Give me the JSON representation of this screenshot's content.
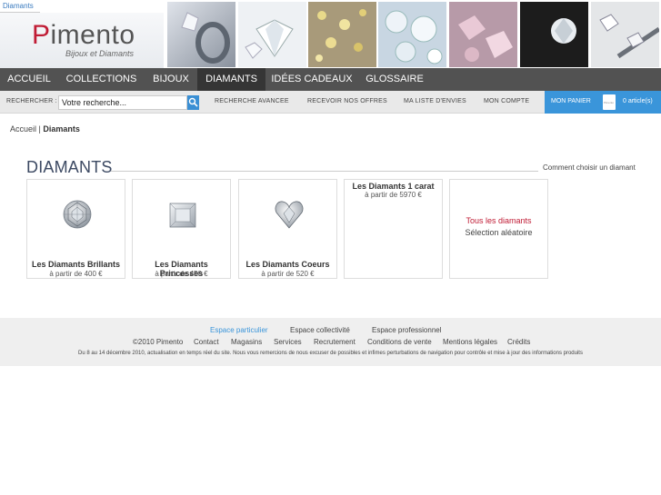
{
  "top_tab": {
    "label": "Diamants"
  },
  "logo": {
    "word_first": "P",
    "word_rest": "imento",
    "tagline": "Bijoux et Diamants"
  },
  "nav": {
    "items": [
      {
        "label": "ACCUEIL",
        "active": false
      },
      {
        "label": "COLLECTIONS",
        "active": false
      },
      {
        "label": "BIJOUX",
        "active": false
      },
      {
        "label": "DIAMANTS",
        "active": true
      },
      {
        "label": "IDÉES CADEAUX",
        "active": false
      },
      {
        "label": "GLOSSAIRE",
        "active": false
      }
    ]
  },
  "toolbar": {
    "search_label": "RECHERCHER :",
    "search_value": "Votre recherche...",
    "advanced": "RECHERCHE AVANCEE",
    "offers": "RECEVOIR NOS OFFRES",
    "wishlist": "MA LISTE D'ENVIES",
    "account": "MON COMPTE",
    "cart_label": "MON PANIER",
    "cart_count": "0 article(s)",
    "cart_bag_text": "Pimento"
  },
  "breadcrumb": {
    "home": "Accueil",
    "separator": " | ",
    "current": "Diamants"
  },
  "section": {
    "title": "DIAMANTS",
    "choose_link": "Comment choisir un diamant"
  },
  "cards": [
    {
      "title": "Les Diamants Brillants",
      "price": "à partir de 400 €",
      "shape": "round"
    },
    {
      "title": "Les Diamants Princesses",
      "price": "à partir de 450 €",
      "shape": "princess"
    },
    {
      "title": "Les Diamants Coeurs",
      "price": "à partir de 520 €",
      "shape": "heart"
    },
    {
      "title": "Les Diamants 1 carat",
      "price": "à partir de 5970 €",
      "shape": "none"
    }
  ],
  "extra_card": {
    "all_link": "Tous les diamants",
    "random_link": "Sélection aléatoire"
  },
  "footer": {
    "spaces": [
      "Espace particulier",
      "Espace collectivité",
      "Espace professionnel"
    ],
    "links": [
      "©2010 Pimento",
      "Contact",
      "Magasins",
      "Services",
      "Recrutement",
      "Conditions de vente",
      "Mentions légales",
      "Crédits"
    ],
    "notice": "Du 8 au 14 décembre 2010, actualisation en temps réel du site. Nous vous remercions de nous excuser de possibles et infimes perturbations de navigation pour contrôle et mise à jour des informations produits"
  },
  "colors": {
    "accent_blue": "#3a95da",
    "nav_bg": "#525252",
    "brand_red": "#c01c35"
  }
}
